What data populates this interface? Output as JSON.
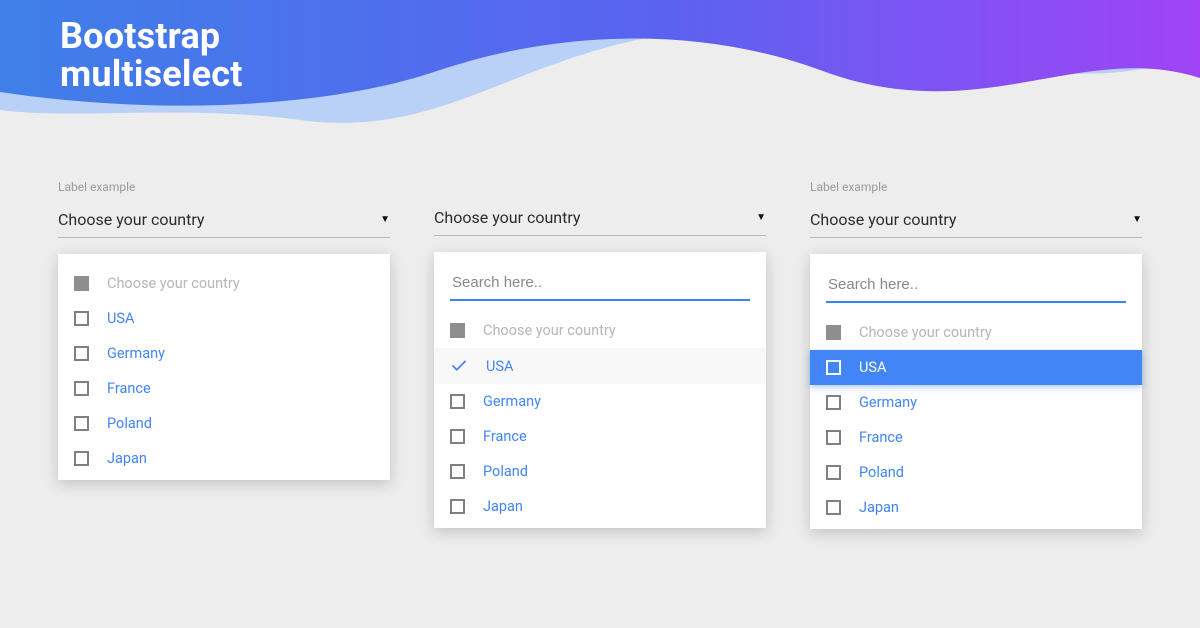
{
  "title": "Bootstrap\nmultiselect",
  "search_placeholder": "Search here..",
  "countries": [
    "USA",
    "Germany",
    "France",
    "Poland",
    "Japan"
  ],
  "col1": {
    "label": "Label example",
    "value": "Choose your country",
    "placeholder": "Choose your country"
  },
  "col2": {
    "value": "Choose your country",
    "placeholder": "Choose your country",
    "selected": [
      "USA"
    ]
  },
  "col3": {
    "label": "Label example",
    "value": "Choose your country",
    "placeholder": "Choose your country",
    "highlighted": "USA"
  }
}
